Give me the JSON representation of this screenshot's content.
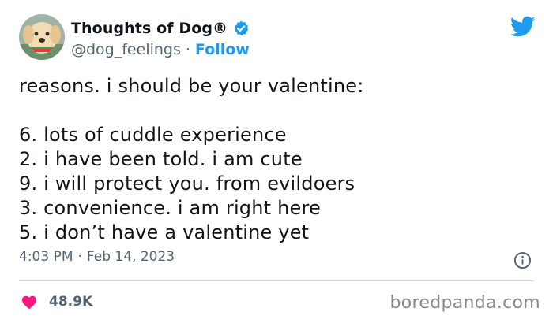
{
  "author": {
    "display_name": "Thoughts of Dog®",
    "handle": "@dog_feelings",
    "separator": "·",
    "follow_label": "Follow"
  },
  "tweet": {
    "text": "reasons. i should be your valentine:\n\n6. lots of cuddle experience\n2. i have been told. i am cute\n9. i will protect you. from evildoers\n3. convenience. i am right here\n5. i don’t have a valentine yet",
    "time": "4:03 PM",
    "separator": "·",
    "date": "Feb 14, 2023"
  },
  "engagement": {
    "likes": "48.9K"
  },
  "watermark": "boredpanda.com",
  "icons": {
    "verified": "verified-badge-icon",
    "twitter": "twitter-bird-icon",
    "info": "info-icon",
    "like": "heart-icon"
  },
  "colors": {
    "accent": "#1d9bf0",
    "like": "#f91880",
    "secondary_text": "#536471",
    "primary_text": "#0f1419"
  }
}
